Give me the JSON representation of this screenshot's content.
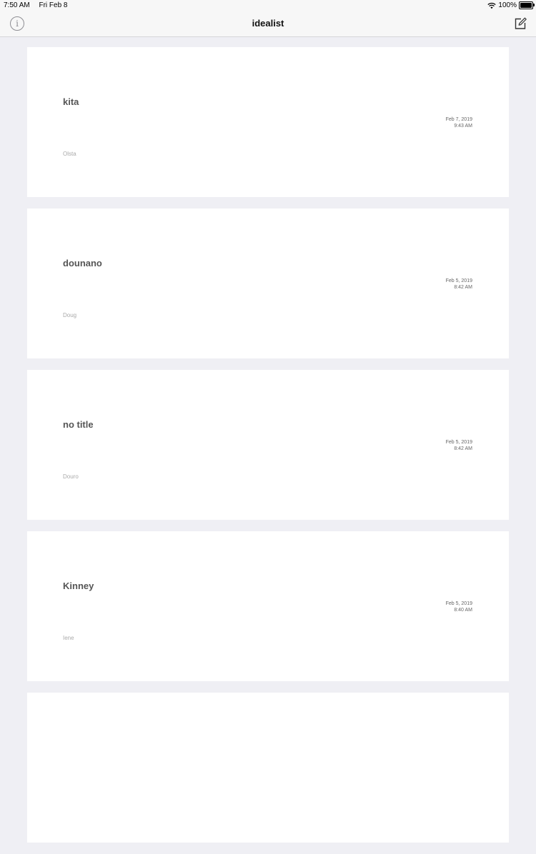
{
  "status_bar": {
    "time": "7:50 AM",
    "date": "Fri Feb 8",
    "battery": "100%"
  },
  "nav": {
    "title": "idealist",
    "info_glyph": "i"
  },
  "ideas": [
    {
      "title": "kita",
      "date": "Feb 7, 2019",
      "time": "9:43 AM",
      "author": "Olsta"
    },
    {
      "title": "dounano",
      "date": "Feb 5, 2019",
      "time": "8:42 AM",
      "author": "Doug"
    },
    {
      "title": "no title",
      "date": "Feb 5, 2019",
      "time": "8:42 AM",
      "author": "Douro"
    },
    {
      "title": "Kinney",
      "date": "Feb 5, 2019",
      "time": "8:40 AM",
      "author": "Iene"
    },
    {
      "title": "",
      "date": "",
      "time": "",
      "author": ""
    }
  ],
  "icons": {
    "info": "info-icon",
    "compose": "compose-icon",
    "wifi": "wifi-icon",
    "battery": "battery-icon"
  }
}
